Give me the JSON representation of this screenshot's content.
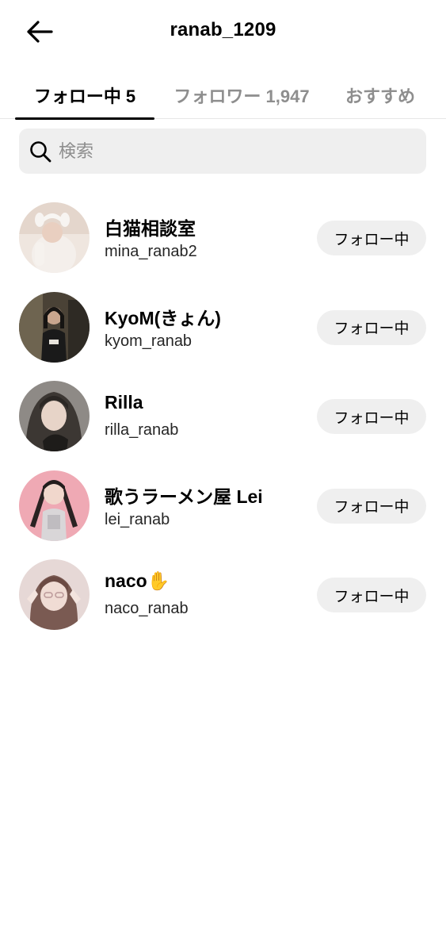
{
  "header": {
    "title": "ranab_1209",
    "back_icon": "arrow-left-icon"
  },
  "tabs": [
    {
      "label": "フォロー中 5",
      "active": true
    },
    {
      "label": "フォロワー 1,947",
      "active": false
    },
    {
      "label": "おすすめ",
      "active": false
    }
  ],
  "search": {
    "placeholder": "検索",
    "icon": "search-icon"
  },
  "following": [
    {
      "name": "白猫相談室",
      "handle": "mina_ranab2",
      "button": "フォロー中"
    },
    {
      "name": "KyoM(きょん)",
      "handle": "kyom_ranab",
      "button": "フォロー中"
    },
    {
      "name": "Rilla",
      "handle": "rilla_ranab",
      "button": "フォロー中"
    },
    {
      "name": "歌うラーメン屋 Lei",
      "handle": "lei_ranab",
      "button": "フォロー中"
    },
    {
      "name": "naco✋",
      "handle": "naco_ranab",
      "button": "フォロー中"
    }
  ],
  "colors": {
    "text": "#000000",
    "secondary": "#8e8e8e",
    "button_bg": "#efefef",
    "search_bg": "#efefef"
  }
}
